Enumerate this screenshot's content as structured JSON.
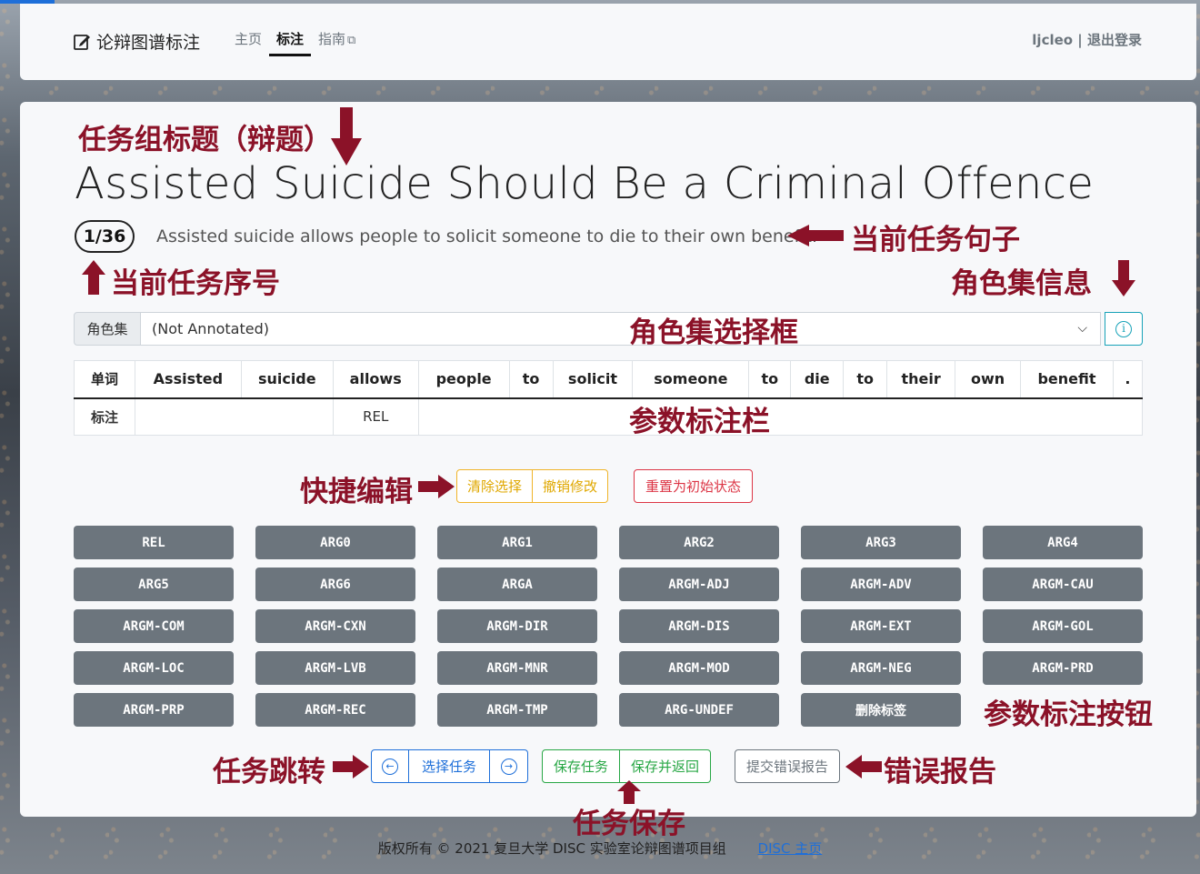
{
  "navbar": {
    "brand": "论辩图谱标注",
    "links": [
      "主页",
      "标注",
      "指南"
    ],
    "user": "ljcleo | 退出登录"
  },
  "task": {
    "title": "Assisted Suicide Should Be a Criminal Offence",
    "index": "1/36",
    "sentence": "Assisted suicide allows people to solicit someone to die to their own benefit."
  },
  "roleset": {
    "label": "角色集",
    "selected": "(Not Annotated)"
  },
  "table": {
    "row_word_label": "单词",
    "row_tag_label": "标注",
    "words": [
      "Assisted",
      "suicide",
      "allows",
      "people",
      "to",
      "solicit",
      "someone",
      "to",
      "die",
      "to",
      "their",
      "own",
      "benefit",
      "."
    ],
    "tags": [
      "",
      "REL",
      ""
    ]
  },
  "quick_edit": {
    "clear": "清除选择",
    "undo": "撤销修改",
    "reset": "重置为初始状态"
  },
  "arg_buttons": [
    "REL",
    "ARG0",
    "ARG1",
    "ARG2",
    "ARG3",
    "ARG4",
    "ARG5",
    "ARG6",
    "ARGA",
    "ARGM-ADJ",
    "ARGM-ADV",
    "ARGM-CAU",
    "ARGM-COM",
    "ARGM-CXN",
    "ARGM-DIR",
    "ARGM-DIS",
    "ARGM-EXT",
    "ARGM-GOL",
    "ARGM-LOC",
    "ARGM-LVB",
    "ARGM-MNR",
    "ARGM-MOD",
    "ARGM-NEG",
    "ARGM-PRD",
    "ARGM-PRP",
    "ARGM-REC",
    "ARGM-TMP",
    "ARG-UNDEF",
    "删除标签"
  ],
  "task_nav": {
    "select": "选择任务",
    "save": "保存任务",
    "save_return": "保存并返回",
    "report": "提交错误报告"
  },
  "footer": {
    "copyright": "版权所有 © 2021 复旦大学 DISC 实验室论辩图谱项目组",
    "link": "DISC 主页"
  },
  "annotations": {
    "title": "任务组标题（辩题）",
    "sentence": "当前任务句子",
    "index": "当前任务序号",
    "roleset_info": "角色集信息",
    "roleset_select": "角色集选择框",
    "arg_bar": "参数标注栏",
    "quick_edit": "快捷编辑",
    "arg_buttons": "参数标注按钮",
    "task_jump": "任务跳转",
    "error_report": "错误报告",
    "task_save": "任务保存"
  },
  "colors": {
    "annotation": "#8b1228",
    "primary": "#1e6fd9",
    "success": "#28a745",
    "warning": "#f0b429",
    "danger": "#dc3545",
    "secondary": "#6c757d",
    "info": "#17a2b8"
  }
}
